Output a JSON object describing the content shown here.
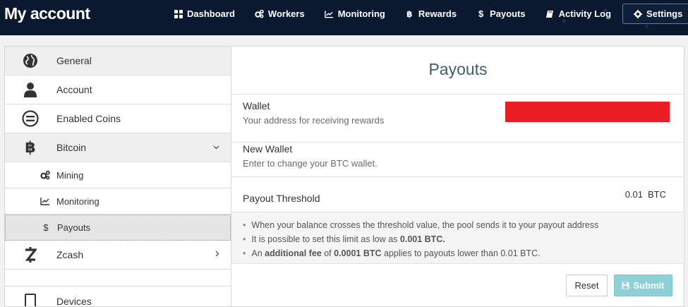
{
  "header": {
    "brand": "My account",
    "nav": [
      {
        "label": "Dashboard",
        "icon": "dashboard-icon"
      },
      {
        "label": "Workers",
        "icon": "cogs-icon"
      },
      {
        "label": "Monitoring",
        "icon": "line-chart-icon"
      },
      {
        "label": "Rewards",
        "icon": "bitcoin-icon"
      },
      {
        "label": "Payouts",
        "icon": "dollar-icon"
      },
      {
        "label": "Activity Log",
        "icon": "book-icon"
      },
      {
        "label": "Settings",
        "icon": "gear-icon"
      }
    ]
  },
  "sidebar": {
    "items": [
      {
        "label": "General",
        "icon": "globe-icon"
      },
      {
        "label": "Account",
        "icon": "user-icon"
      },
      {
        "label": "Enabled Coins",
        "icon": "equals-circle-icon"
      },
      {
        "label": "Bitcoin",
        "icon": "bitcoin-icon",
        "expanded": true
      },
      {
        "label": "Mining",
        "icon": "cogs-icon"
      },
      {
        "label": "Monitoring",
        "icon": "line-chart-icon"
      },
      {
        "label": "Payouts",
        "icon": "dollar-icon",
        "active": true
      },
      {
        "label": "Zcash",
        "icon": "zcash-icon",
        "expanded": false
      },
      {
        "label": "Devices",
        "icon": "tablet-icon"
      }
    ]
  },
  "main": {
    "title": "Payouts",
    "wallet": {
      "label": "Wallet",
      "help": "Your address for receiving rewards",
      "value_redacted": true
    },
    "new_wallet": {
      "label": "New Wallet",
      "help": "Enter to change your BTC wallet."
    },
    "threshold": {
      "label": "Payout Threshold",
      "value": "0.01",
      "unit": "BTC"
    },
    "notes": {
      "n1": "When your balance crosses the threshold value, the pool sends it to your payout address",
      "n2_pre": "It is possible to set this limit as low as ",
      "n2_bold": "0.001 BTC.",
      "n3_pre": "An ",
      "n3_bold1": "additional fee",
      "n3_mid": " of ",
      "n3_bold2": "0.0001 BTC",
      "n3_post": " applies to payouts lower than 0.01 BTC."
    },
    "buttons": {
      "reset": "Reset",
      "submit": "Submit"
    }
  },
  "colors": {
    "topbar": "#0b1930",
    "title": "#3d6060",
    "redaction": "#ea1c24",
    "submit": "#8ed0d6"
  }
}
